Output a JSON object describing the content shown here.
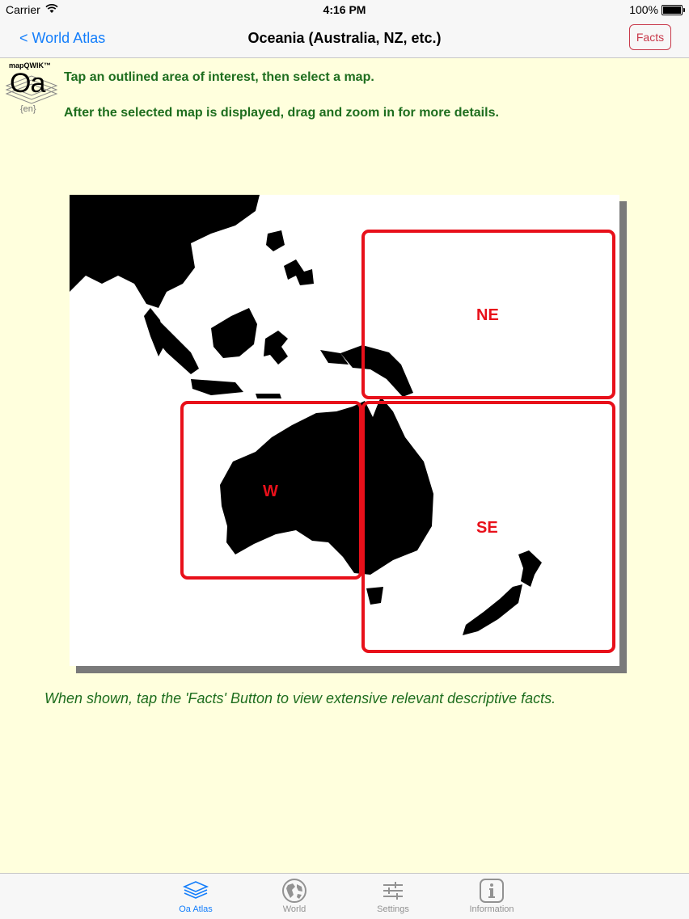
{
  "status": {
    "carrier": "Carrier",
    "time": "4:16 PM",
    "battery": "100%"
  },
  "nav": {
    "back_label": "< World Atlas",
    "title": "Oceania (Australia, NZ, etc.)",
    "facts_label": "Facts"
  },
  "logo": {
    "brand": "mapQWIK™",
    "code": "Oa",
    "lang": "{en}"
  },
  "instructions": {
    "line1": "Tap an outlined area of interest, then select a map.",
    "line2": "After the selected map is displayed, drag and zoom in for more details."
  },
  "map": {
    "regions": [
      {
        "id": "ne",
        "label": "NE"
      },
      {
        "id": "w",
        "label": "W"
      },
      {
        "id": "se",
        "label": "SE"
      }
    ],
    "region_color": "#E8101A"
  },
  "footer_note": "When shown, tap the 'Facts' Button to view extensive relevant descriptive facts.",
  "tabs": [
    {
      "label": "Oa Atlas",
      "icon": "layers-icon",
      "active": true
    },
    {
      "label": "World",
      "icon": "globe-icon",
      "active": false
    },
    {
      "label": "Settings",
      "icon": "sliders-icon",
      "active": false
    },
    {
      "label": "Information",
      "icon": "info-icon",
      "active": false
    }
  ],
  "colors": {
    "background": "#FFFFDD",
    "accent": "#147EFB",
    "instruction_text": "#1E6E1E",
    "facts_button": "#C8394A"
  }
}
